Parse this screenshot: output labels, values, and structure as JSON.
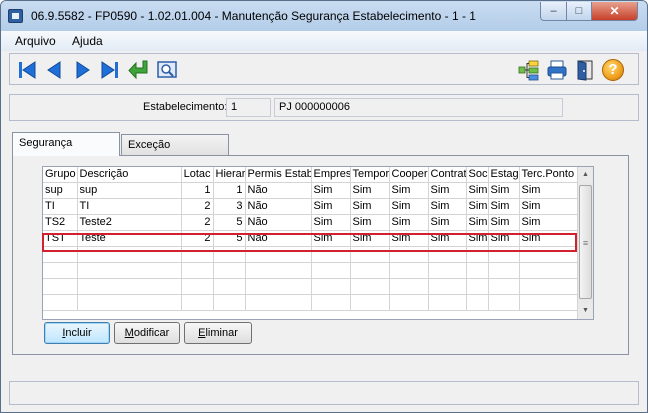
{
  "window": {
    "title": "06.9.5582 - FP0590 - 1.02.01.004 - Manutenção Segurança Estabelecimento - 1 - 1",
    "minimize": "‒",
    "maximize": "□",
    "close": "✕"
  },
  "menu": {
    "items": [
      "Arquivo",
      "Ajuda"
    ]
  },
  "toolbar": {
    "icons": [
      "first-record-icon",
      "previous-record-icon",
      "next-record-icon",
      "last-record-icon",
      "return-icon",
      "zoom-icon",
      "structure-icon",
      "print-icon",
      "exit-door-icon",
      "help-icon"
    ],
    "help_glyph": "?"
  },
  "header": {
    "label": "Estabelecimento:",
    "code": "1",
    "name": "PJ 000000006"
  },
  "tabs": [
    {
      "label": "Segurança",
      "active": true
    },
    {
      "label": "Exceção",
      "active": false
    }
  ],
  "grid": {
    "columns": [
      "Grupo",
      "Descrição",
      "Lotac",
      "Hierar",
      "Permis Estab",
      "Empres",
      "Tempor",
      "Cooper",
      "Contrat",
      "Soc",
      "Estag",
      "Terc.Ponto"
    ],
    "rows": [
      [
        "sup",
        "sup",
        "1",
        "1",
        "Não",
        "Sim",
        "Sim",
        "Sim",
        "Sim",
        "Sim",
        "Sim",
        "Sim"
      ],
      [
        "TI",
        "TI",
        "2",
        "3",
        "Não",
        "Sim",
        "Sim",
        "Sim",
        "Sim",
        "Sim",
        "Sim",
        "Sim"
      ],
      [
        "TS2",
        "Teste2",
        "2",
        "5",
        "Não",
        "Sim",
        "Sim",
        "Sim",
        "Sim",
        "Sim",
        "Sim",
        "Sim"
      ],
      [
        "TST",
        "Teste",
        "2",
        "5",
        "Não",
        "Sim",
        "Sim",
        "Sim",
        "Sim",
        "Sim",
        "Sim",
        "Sim"
      ]
    ],
    "highlighted_row": 3,
    "empty_rows": 4,
    "scroll_grip": "≡"
  },
  "buttons": {
    "incluir": "Incluir",
    "modificar": "Modificar",
    "eliminar": "Eliminar"
  },
  "colors": {
    "highlight_outline": "#d2202e",
    "title_gradient": "#c9dcf1",
    "nav_blue": "#1f6fd6",
    "return_green": "#3da53a",
    "help_orange": "#f0a020"
  }
}
